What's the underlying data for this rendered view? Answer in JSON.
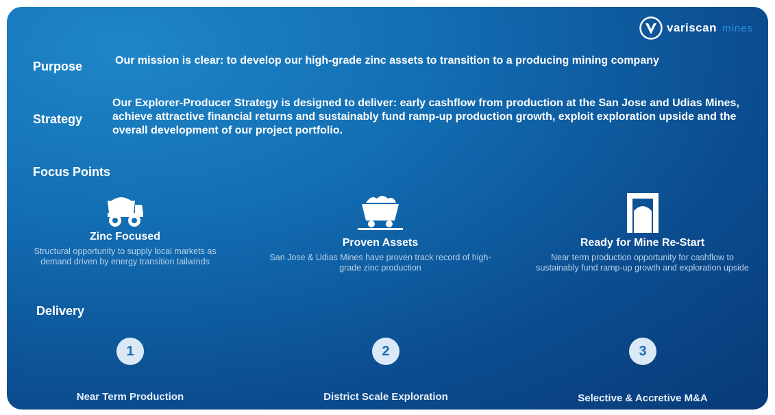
{
  "brand": {
    "name": "variscan",
    "suffix": "mines",
    "icon": "variscan-v-logo-icon"
  },
  "purpose": {
    "label": "Purpose",
    "text": "Our mission is clear: to develop our high-grade zinc assets to transition to a producing mining company"
  },
  "strategy": {
    "label": "Strategy",
    "text": "Our Explorer-Producer Strategy is designed to deliver: early cashflow from production at the San Jose and Udias Mines, achieve attractive financial returns and sustainably fund ramp-up production growth, exploit exploration upside and the overall development of our project portfolio."
  },
  "focus": {
    "heading": "Focus Points",
    "items": [
      {
        "icon": "mining-truck-icon",
        "title": "Zinc Focused",
        "desc": "Structural opportunity to supply local markets as demand driven by energy transition tailwinds"
      },
      {
        "icon": "mine-cart-icon",
        "title": "Proven Assets",
        "desc": "San Jose & Udias Mines have proven track record of high-grade zinc production"
      },
      {
        "icon": "mine-entrance-icon",
        "title": "Ready for Mine Re-Start",
        "desc": "Near term production opportunity for cashflow to sustainably fund ramp-up growth and exploration upside"
      }
    ]
  },
  "delivery": {
    "heading": "Delivery",
    "items": [
      {
        "num": "1",
        "title": "Near Term Production"
      },
      {
        "num": "2",
        "title": "District Scale Exploration"
      },
      {
        "num": "3",
        "title": "Selective & Accretive M&A"
      }
    ]
  },
  "colors": {
    "background_light": "#1f86c8",
    "background_dark": "#083a78",
    "desc_text": "#b9d3ea",
    "number_circle": "#dbe9f6",
    "number_text": "#1a6db5",
    "logo_accent": "#2a8fd6"
  }
}
